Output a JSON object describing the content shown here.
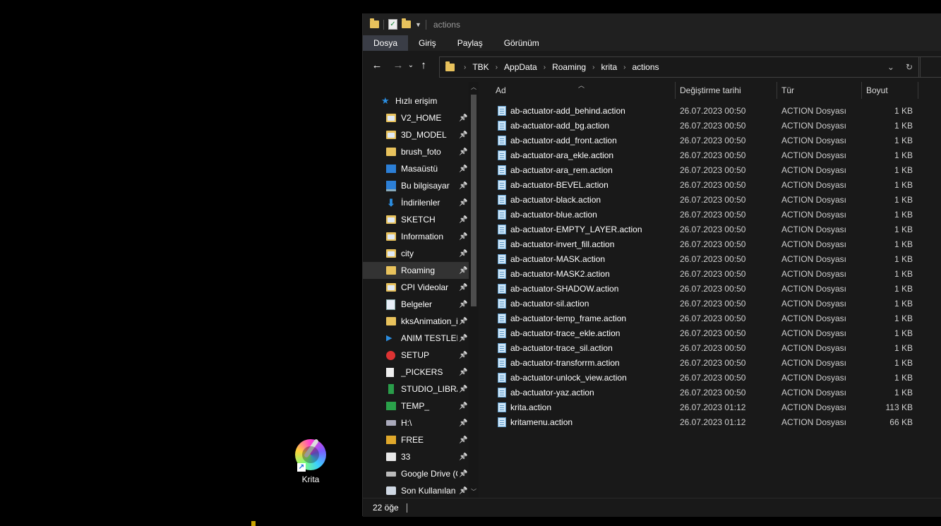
{
  "desktop": {
    "icon_label": "Krita",
    "icon": "krita-logo-icon"
  },
  "window": {
    "title": "actions"
  },
  "ribbon": {
    "tabs": [
      {
        "label": "Dosya",
        "active": true
      },
      {
        "label": "Giriş",
        "active": false
      },
      {
        "label": "Paylaş",
        "active": false
      },
      {
        "label": "Görünüm",
        "active": false
      }
    ]
  },
  "address": {
    "crumbs": [
      "TBK",
      "AppData",
      "Roaming",
      "krita",
      "actions"
    ]
  },
  "nav": {
    "quick_access": "Hızlı erişim",
    "items": [
      {
        "label": "V2_HOME",
        "icon": "photo-folder-icon",
        "kind": "photo"
      },
      {
        "label": "3D_MODEL",
        "icon": "photo-folder-icon",
        "kind": "photo"
      },
      {
        "label": "brush_foto",
        "icon": "folder-icon",
        "kind": "folder"
      },
      {
        "label": "Masaüstü",
        "icon": "desktop-icon",
        "kind": "desk"
      },
      {
        "label": "Bu bilgisayar",
        "icon": "computer-icon",
        "kind": "pc"
      },
      {
        "label": "İndirilenler",
        "icon": "download-icon",
        "kind": "dl"
      },
      {
        "label": "SKETCH",
        "icon": "photo-folder-icon",
        "kind": "photo"
      },
      {
        "label": "Information",
        "icon": "photo-folder-icon",
        "kind": "photo"
      },
      {
        "label": "city",
        "icon": "photo-folder-icon",
        "kind": "photo"
      },
      {
        "label": "Roaming",
        "icon": "folder-icon",
        "kind": "folder",
        "selected": true
      },
      {
        "label": "CPI Videolar",
        "icon": "photo-folder-icon",
        "kind": "photo"
      },
      {
        "label": "Belgeler",
        "icon": "documents-icon",
        "kind": "doc"
      },
      {
        "label": "kksAnimation_i",
        "icon": "folder-icon",
        "kind": "folder"
      },
      {
        "label": "ANIM TESTLER",
        "icon": "play-icon",
        "kind": "play"
      },
      {
        "label": "SETUP",
        "icon": "setup-icon",
        "kind": "setup"
      },
      {
        "label": "_PICKERS",
        "icon": "pickers-icon",
        "kind": "pick"
      },
      {
        "label": "STUDIO_LIBRAR",
        "icon": "book-icon",
        "kind": "book"
      },
      {
        "label": "TEMP_",
        "icon": "temp-icon",
        "kind": "temp"
      },
      {
        "label": "H:\\",
        "icon": "drive-icon",
        "kind": "drive"
      },
      {
        "label": "FREE",
        "icon": "free-icon",
        "kind": "free"
      },
      {
        "label": "33",
        "icon": "file-33-icon",
        "kind": "33"
      },
      {
        "label": "Google Drive (C",
        "icon": "google-drive-icon",
        "kind": "gd"
      },
      {
        "label": "Son Kullanılan (",
        "icon": "recent-icon",
        "kind": "net"
      }
    ]
  },
  "columns": {
    "name": "Ad",
    "date": "Değiştirme tarihi",
    "type": "Tür",
    "size": "Boyut"
  },
  "files": [
    {
      "name": "ab-actuator-add_behind.action",
      "date": "26.07.2023 00:50",
      "type": "ACTION Dosyası",
      "size": "1 KB"
    },
    {
      "name": "ab-actuator-add_bg.action",
      "date": "26.07.2023 00:50",
      "type": "ACTION Dosyası",
      "size": "1 KB"
    },
    {
      "name": "ab-actuator-add_front.action",
      "date": "26.07.2023 00:50",
      "type": "ACTION Dosyası",
      "size": "1 KB"
    },
    {
      "name": "ab-actuator-ara_ekle.action",
      "date": "26.07.2023 00:50",
      "type": "ACTION Dosyası",
      "size": "1 KB"
    },
    {
      "name": "ab-actuator-ara_rem.action",
      "date": "26.07.2023 00:50",
      "type": "ACTION Dosyası",
      "size": "1 KB"
    },
    {
      "name": "ab-actuator-BEVEL.action",
      "date": "26.07.2023 00:50",
      "type": "ACTION Dosyası",
      "size": "1 KB"
    },
    {
      "name": "ab-actuator-black.action",
      "date": "26.07.2023 00:50",
      "type": "ACTION Dosyası",
      "size": "1 KB"
    },
    {
      "name": "ab-actuator-blue.action",
      "date": "26.07.2023 00:50",
      "type": "ACTION Dosyası",
      "size": "1 KB"
    },
    {
      "name": "ab-actuator-EMPTY_LAYER.action",
      "date": "26.07.2023 00:50",
      "type": "ACTION Dosyası",
      "size": "1 KB"
    },
    {
      "name": "ab-actuator-invert_fill.action",
      "date": "26.07.2023 00:50",
      "type": "ACTION Dosyası",
      "size": "1 KB"
    },
    {
      "name": "ab-actuator-MASK.action",
      "date": "26.07.2023 00:50",
      "type": "ACTION Dosyası",
      "size": "1 KB"
    },
    {
      "name": "ab-actuator-MASK2.action",
      "date": "26.07.2023 00:50",
      "type": "ACTION Dosyası",
      "size": "1 KB"
    },
    {
      "name": "ab-actuator-SHADOW.action",
      "date": "26.07.2023 00:50",
      "type": "ACTION Dosyası",
      "size": "1 KB"
    },
    {
      "name": "ab-actuator-sil.action",
      "date": "26.07.2023 00:50",
      "type": "ACTION Dosyası",
      "size": "1 KB"
    },
    {
      "name": "ab-actuator-temp_frame.action",
      "date": "26.07.2023 00:50",
      "type": "ACTION Dosyası",
      "size": "1 KB"
    },
    {
      "name": "ab-actuator-trace_ekle.action",
      "date": "26.07.2023 00:50",
      "type": "ACTION Dosyası",
      "size": "1 KB"
    },
    {
      "name": "ab-actuator-trace_sil.action",
      "date": "26.07.2023 00:50",
      "type": "ACTION Dosyası",
      "size": "1 KB"
    },
    {
      "name": "ab-actuator-transforrm.action",
      "date": "26.07.2023 00:50",
      "type": "ACTION Dosyası",
      "size": "1 KB"
    },
    {
      "name": "ab-actuator-unlock_view.action",
      "date": "26.07.2023 00:50",
      "type": "ACTION Dosyası",
      "size": "1 KB"
    },
    {
      "name": "ab-actuator-yaz.action",
      "date": "26.07.2023 00:50",
      "type": "ACTION Dosyası",
      "size": "1 KB"
    },
    {
      "name": "krita.action",
      "date": "26.07.2023 01:12",
      "type": "ACTION Dosyası",
      "size": "113 KB"
    },
    {
      "name": "kritamenu.action",
      "date": "26.07.2023 01:12",
      "type": "ACTION Dosyası",
      "size": "66 KB"
    }
  ],
  "status": {
    "count": "22 öğe"
  },
  "colors": {
    "window_bg": "#191919",
    "chrome_bg": "#202020",
    "active_tab": "#3a3d46",
    "selection": "#333333",
    "folder": "#e8c25c",
    "accent": "#2b8de0"
  }
}
